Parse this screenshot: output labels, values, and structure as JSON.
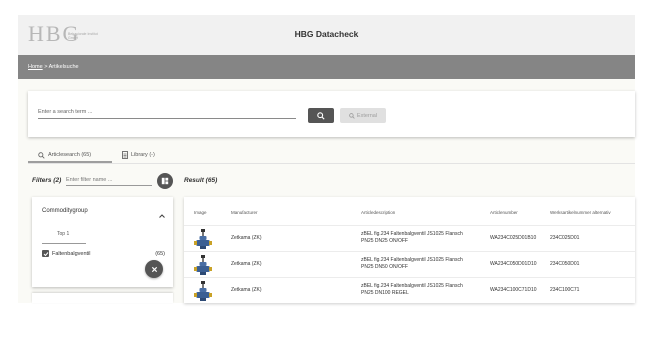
{
  "header": {
    "logo_text": "HBG",
    "logo_sub": "Behaviorale Institut GmbH",
    "title": "HBG Datacheck"
  },
  "breadcrumb": {
    "home": "Home",
    "separator": " > ",
    "current": "Artikelsuche"
  },
  "search": {
    "placeholder": "Enter a search term ...",
    "external_label": "External"
  },
  "tabs": [
    {
      "label": "Articlesearch (65)"
    },
    {
      "label": "Library (-)"
    }
  ],
  "filters": {
    "label": "Filters (2)",
    "placeholder": "Enter filter name ...",
    "group_title": "Commoditygroup",
    "top_label": "Top 1",
    "option_label": "Faltenbalgventil",
    "option_count": "(65)"
  },
  "result": {
    "label": "Result (65)",
    "columns": [
      "Image",
      "Manufacturer",
      "Articledescription",
      "Articlenumber",
      "Werksartikelnummer alternativ"
    ],
    "rows": [
      {
        "manufacturer": "Zetkama (ZK)",
        "desc1": "zBEL fig.234 Faltenbalgventil JS1025 Flansch",
        "desc2": "PN25 DN25 ON/OFF",
        "number": "WA234C025D01B10",
        "alt": "234C025D01"
      },
      {
        "manufacturer": "Zetkama (ZK)",
        "desc1": "zBEL fig.234 Faltenbalgventil JS1025 Flansch",
        "desc2": "PN25 DN50 ON/OFF",
        "number": "WA234C050D01D10",
        "alt": "234C050D01"
      },
      {
        "manufacturer": "Zetkama (ZK)",
        "desc1": "zBEL fig.234 Faltenbalgventil JS1025 Flansch",
        "desc2": "PN25 DN100 REGEL",
        "number": "WA234C100C71D10",
        "alt": "234C100C71"
      }
    ]
  },
  "icons": {
    "search": "search-icon",
    "external": "search-icon",
    "library": "document-icon",
    "filter": "filter-icon",
    "chevron": "chevron-up-icon",
    "clear": "close-icon",
    "check": "check-icon",
    "valve": "valve-icon"
  },
  "colors": {
    "crumb_bar": "#858585",
    "button_dark": "#555555",
    "button_disabled": "#e0e0e0",
    "content_bg": "#fafaf6"
  }
}
